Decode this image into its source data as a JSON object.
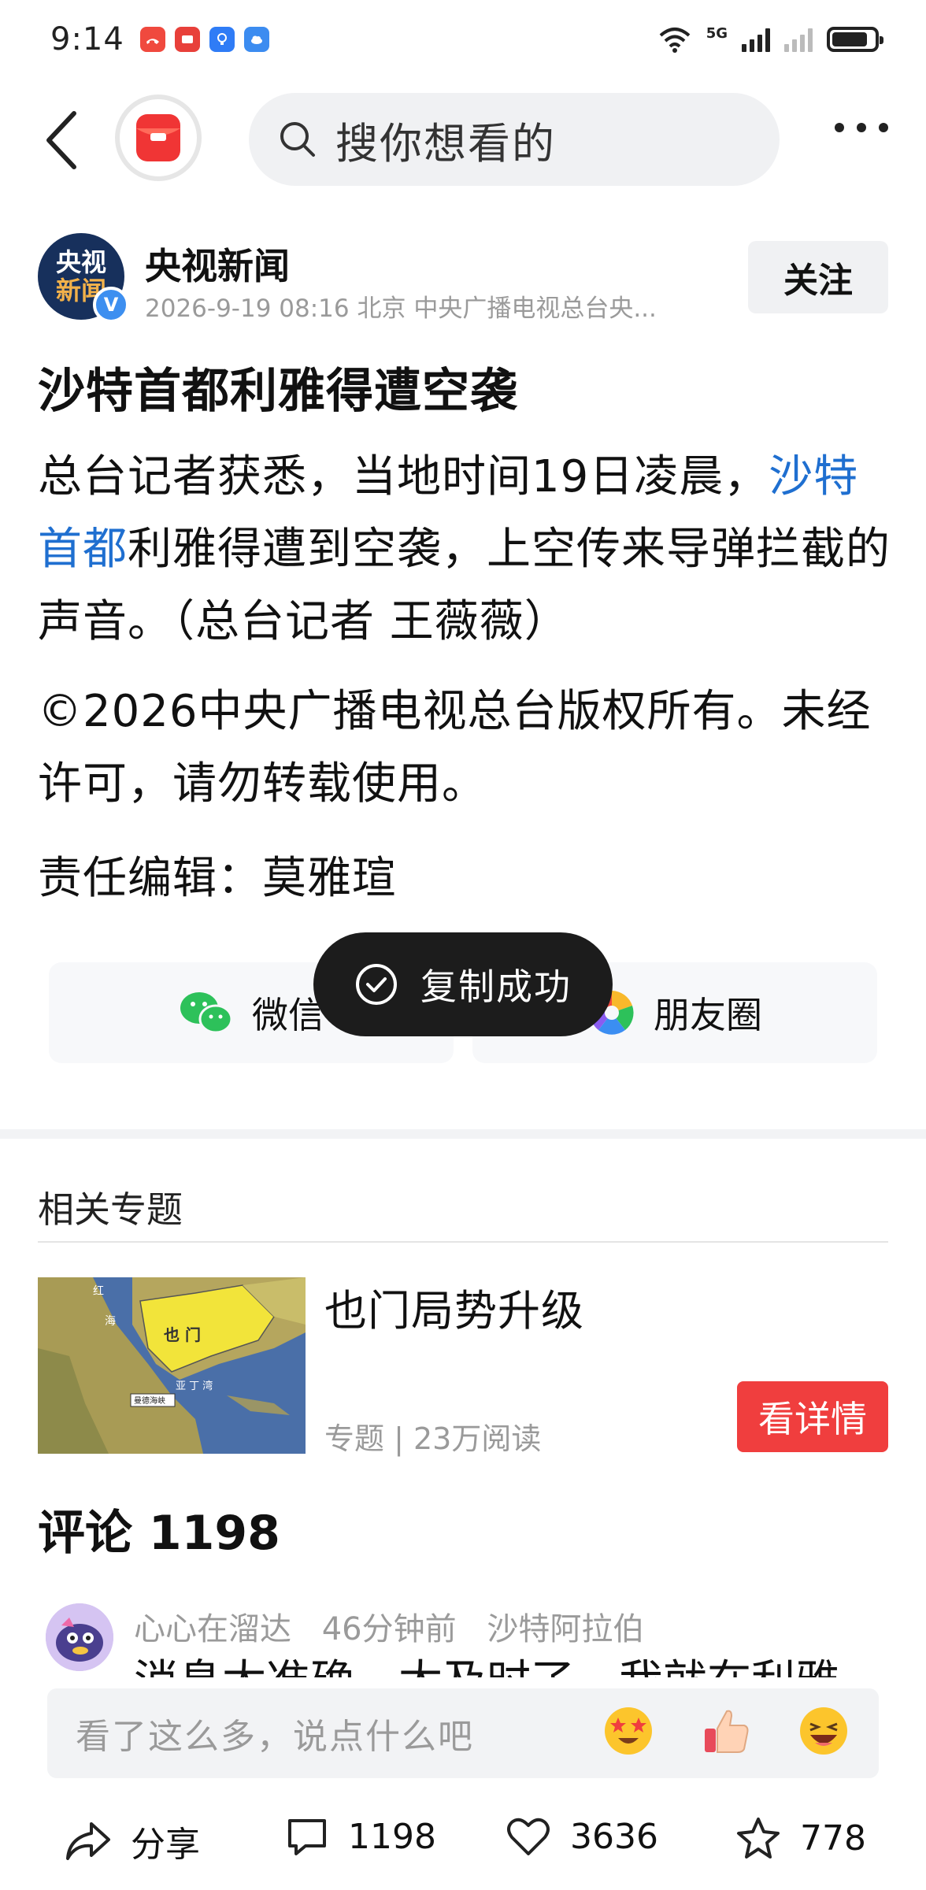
{
  "status_bar": {
    "time": "9:14",
    "network_label": "5G",
    "battery_level": 0.85,
    "app_icons": [
      "missed-call-icon",
      "huawei-app-icon",
      "bulb-app-icon",
      "cloud-app-icon"
    ]
  },
  "top_nav": {
    "search_placeholder": "搜你想看的"
  },
  "author": {
    "avatar_line1": "央视",
    "avatar_line2": "新闻",
    "verified_mark": "V",
    "name": "央视新闻",
    "meta": "2026-9-19  08:16  北京  中央广播电视总台央...",
    "follow_label": "关注"
  },
  "article": {
    "title": "沙特首都利雅得遭空袭",
    "body_part1": "总台记者获悉，当地时间19日凌晨，",
    "body_link": "沙特首都",
    "body_part2": "利雅得遭到空袭，上空传来导弹拦截的声音。（总台记者 王薇薇）",
    "copyright": "©2026中央广播电视总台版权所有。未经许可，请勿转载使用。",
    "editor": "责任编辑：莫雅瑄"
  },
  "share": {
    "wechat_label": "微信",
    "moments_label": "朋友圈"
  },
  "toast": {
    "text": "复制成功"
  },
  "related": {
    "heading": "相关专题",
    "title": "也门局势升级",
    "meta": "专题 | 23万阅读",
    "detail_button": "看详情",
    "map_labels": {
      "sea": "红",
      "sea2": "海",
      "country": "也 门",
      "gulf": "亚 丁 湾",
      "strait": "曼德海峡"
    }
  },
  "comments": {
    "title": "评论 1198",
    "first": {
      "user": "心心在溜达",
      "time": "46分钟前",
      "location": "沙特阿拉伯",
      "preview": "消息太准确，太及时了，我就在利雅"
    }
  },
  "input_bar": {
    "placeholder": "看了这么多，说点什么吧",
    "emojis": [
      "star-eyes-emoji-icon",
      "thumbs-up-emoji-icon",
      "laughing-emoji-icon"
    ]
  },
  "bottom_bar": {
    "share_label": "分享",
    "comment_count": "1198",
    "like_count": "3636",
    "favorite_count": "778"
  },
  "colors": {
    "link": "#1f6fd0",
    "detail_button": "#f03e3e",
    "toast_bg": "#1c1c1c",
    "verified": "#3d8ff0"
  }
}
